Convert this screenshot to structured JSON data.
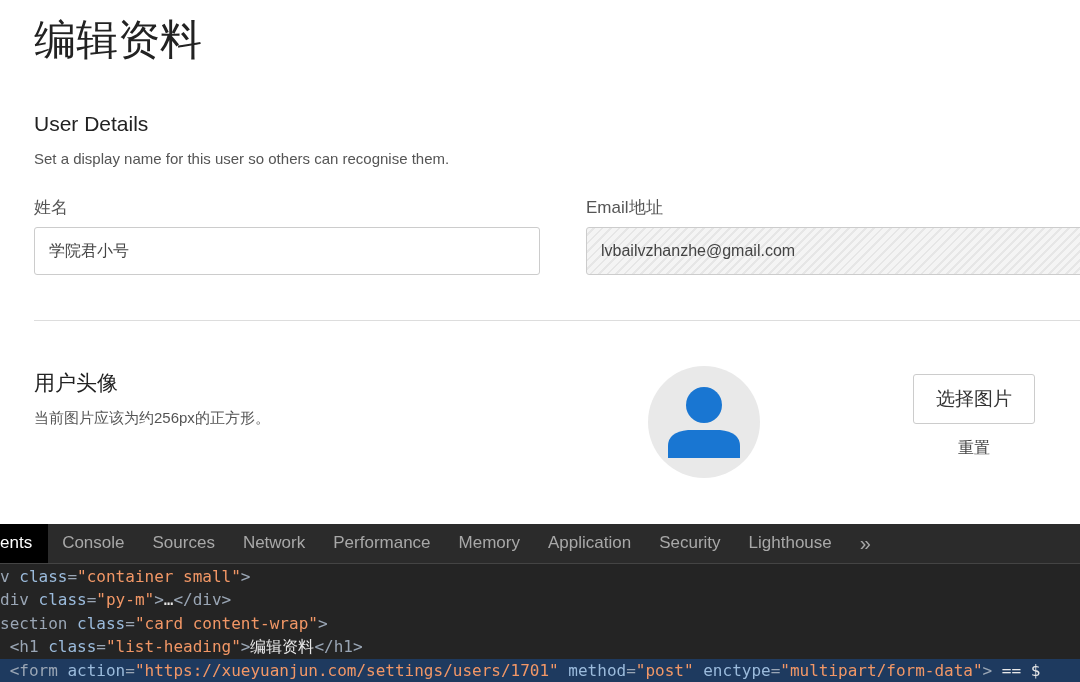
{
  "page": {
    "title": "编辑资料"
  },
  "details": {
    "heading": "User Details",
    "description": "Set a display name for this user so others can recognise them.",
    "fields": [
      {
        "label": "姓名",
        "value": "学院君小号",
        "kind": "text"
      },
      {
        "label": "Email地址",
        "value": "lvbailvzhanzhe@gmail.com",
        "kind": "readonly"
      }
    ]
  },
  "avatar": {
    "heading": "用户头像",
    "description": "当前图片应该为约256px的正方形。",
    "button": "选择图片",
    "reset": "重置"
  },
  "devtools": {
    "tabs": [
      {
        "label": "ents",
        "selected": true
      },
      {
        "label": "Console",
        "selected": false
      },
      {
        "label": "Sources",
        "selected": false
      },
      {
        "label": "Network",
        "selected": false
      },
      {
        "label": "Performance",
        "selected": false
      },
      {
        "label": "Memory",
        "selected": false
      },
      {
        "label": "Application",
        "selected": false
      },
      {
        "label": "Security",
        "selected": false
      },
      {
        "label": "Lighthouse",
        "selected": false
      }
    ],
    "more": "»",
    "lines": [
      {
        "selected": false,
        "tokens": [
          {
            "kind": "tag",
            "text": "v"
          },
          {
            "kind": "attr",
            "text": " class"
          },
          {
            "kind": "tag",
            "text": "="
          },
          {
            "kind": "value",
            "text": "\"container small\""
          },
          {
            "kind": "tag",
            "text": ">"
          }
        ]
      },
      {
        "selected": false,
        "tokens": [
          {
            "kind": "tag",
            "text": "div"
          },
          {
            "kind": "attr",
            "text": " class"
          },
          {
            "kind": "tag",
            "text": "="
          },
          {
            "kind": "value",
            "text": "\"py-m\""
          },
          {
            "kind": "tag",
            "text": ">"
          },
          {
            "kind": "text",
            "text": "…"
          },
          {
            "kind": "tag",
            "text": "</div>"
          }
        ]
      },
      {
        "selected": false,
        "tokens": [
          {
            "kind": "tag",
            "text": "section"
          },
          {
            "kind": "attr",
            "text": " class"
          },
          {
            "kind": "tag",
            "text": "="
          },
          {
            "kind": "value",
            "text": "\"card content-wrap\""
          },
          {
            "kind": "tag",
            "text": ">"
          }
        ]
      },
      {
        "selected": false,
        "tokens": [
          {
            "kind": "tag",
            "text": " <h1"
          },
          {
            "kind": "attr",
            "text": " class"
          },
          {
            "kind": "tag",
            "text": "="
          },
          {
            "kind": "value",
            "text": "\"list-heading\""
          },
          {
            "kind": "tag",
            "text": ">"
          },
          {
            "kind": "text",
            "text": "编辑资料"
          },
          {
            "kind": "tag",
            "text": "</h1>"
          }
        ]
      },
      {
        "selected": true,
        "tokens": [
          {
            "kind": "tag",
            "text": " <form"
          },
          {
            "kind": "attr",
            "text": " action"
          },
          {
            "kind": "tag",
            "text": "="
          },
          {
            "kind": "value",
            "text": "\"https://xueyuanjun.com/settings/users/1701\""
          },
          {
            "kind": "attr",
            "text": " method"
          },
          {
            "kind": "tag",
            "text": "="
          },
          {
            "kind": "value",
            "text": "\"post\""
          },
          {
            "kind": "attr",
            "text": " enctype"
          },
          {
            "kind": "tag",
            "text": "="
          },
          {
            "kind": "value",
            "text": "\"multipart/form-data\""
          },
          {
            "kind": "tag",
            "text": ">"
          },
          {
            "kind": "text",
            "text": " == $"
          }
        ]
      }
    ]
  }
}
